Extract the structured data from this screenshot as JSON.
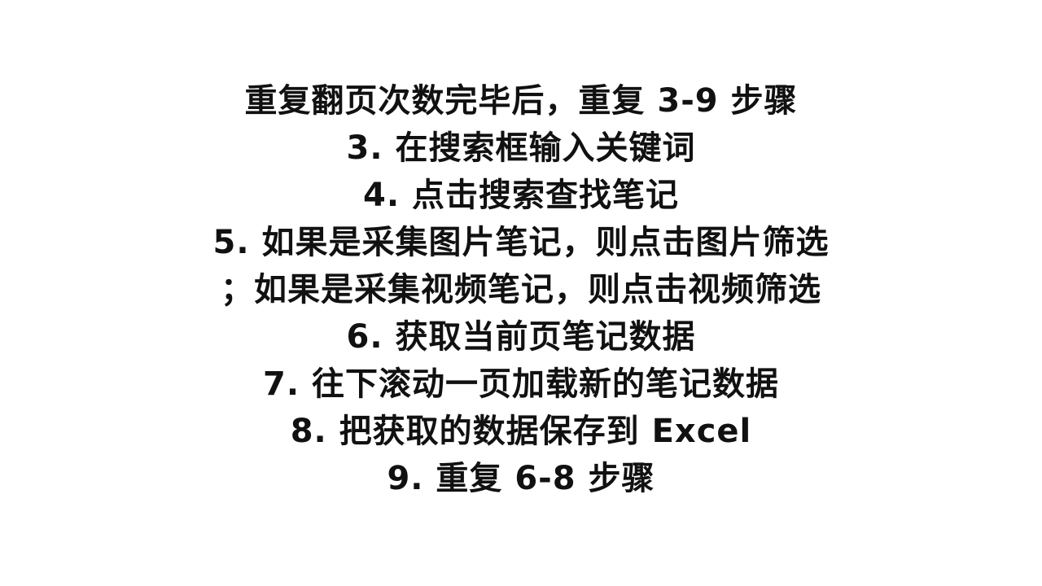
{
  "lines": [
    "重复翻页次数完毕后，重复 3-9 步骤",
    "3. 在搜索框输入关键词",
    "4. 点击搜索查找笔记",
    "5. 如果是采集图片笔记，则点击图片筛选",
    "；如果是采集视频笔记，则点击视频筛选",
    "6. 获取当前页笔记数据",
    "7. 往下滚动一页加载新的笔记数据",
    "8. 把获取的数据保存到 Excel",
    "9. 重复 6-8 步骤"
  ]
}
